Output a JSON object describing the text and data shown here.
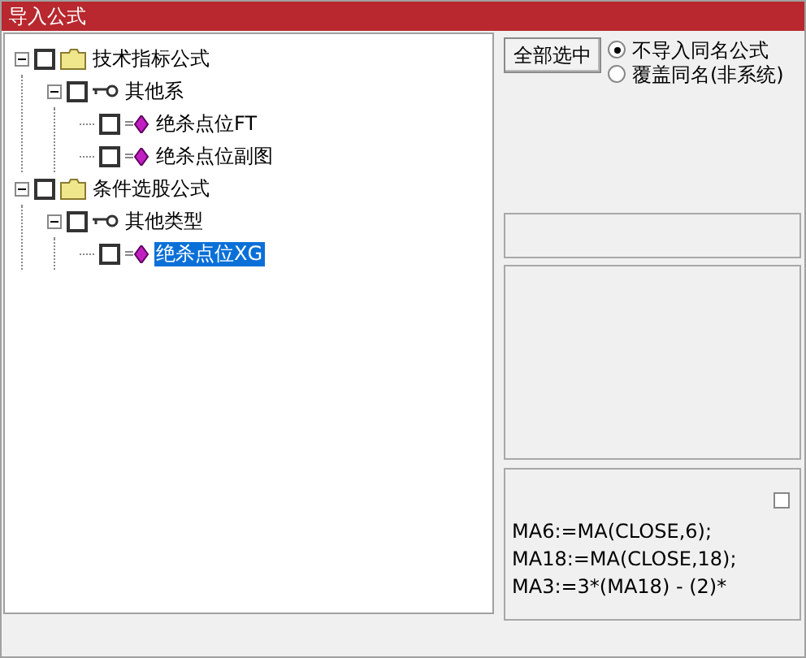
{
  "window": {
    "title": "导入公式"
  },
  "tree": [
    {
      "label": "技术指标公式",
      "kind": "folder",
      "checked": false,
      "expanded": true,
      "children": [
        {
          "label": "其他系",
          "kind": "group",
          "checked": false,
          "expanded": true,
          "children": [
            {
              "label": "绝杀点位FT",
              "kind": "formula",
              "checked": false,
              "selected": false
            },
            {
              "label": "绝杀点位副图",
              "kind": "formula",
              "checked": false,
              "selected": false
            }
          ]
        }
      ]
    },
    {
      "label": "条件选股公式",
      "kind": "folder",
      "checked": false,
      "expanded": true,
      "children": [
        {
          "label": "其他类型",
          "kind": "group",
          "checked": false,
          "expanded": true,
          "children": [
            {
              "label": "绝杀点位XG",
              "kind": "formula",
              "checked": false,
              "selected": true
            }
          ]
        }
      ]
    }
  ],
  "select_all_button": "全部选中",
  "options": [
    {
      "label": "不导入同名公式",
      "selected": true
    },
    {
      "label": "覆盖同名(非系统)",
      "selected": false
    }
  ],
  "code_lines": [
    "MA6:=MA(CLOSE,6);",
    "MA18:=MA(CLOSE,18);",
    "MA3:=3*(MA18) - (2)*"
  ],
  "code_checkbox": {
    "checked": false
  }
}
